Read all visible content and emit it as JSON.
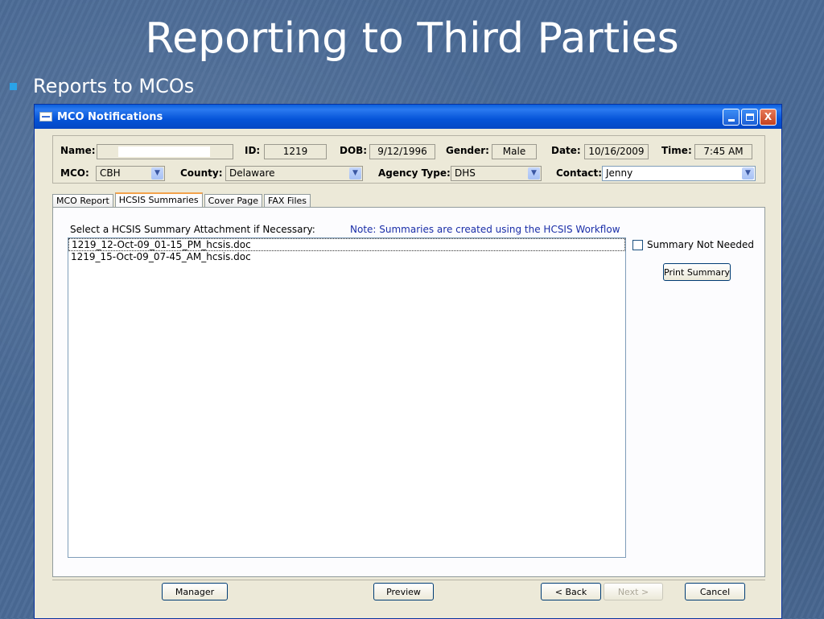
{
  "slide": {
    "title": "Reporting to Third Parties",
    "bullet": "Reports to MCOs"
  },
  "window": {
    "title": "MCO Notifications",
    "min_label": "",
    "close_label": "X"
  },
  "header": {
    "name_label": "Name:",
    "name_value": "",
    "id_label": "ID:",
    "id_value": "1219",
    "dob_label": "DOB:",
    "dob_value": "9/12/1996",
    "gender_label": "Gender:",
    "gender_value": "Male",
    "date_label": "Date:",
    "date_value": "10/16/2009",
    "time_label": "Time:",
    "time_value": "7:45 AM",
    "mco_label": "MCO:",
    "mco_value": "CBH",
    "county_label": "County:",
    "county_value": "Delaware",
    "agency_label": "Agency Type:",
    "agency_value": "DHS",
    "contact_label": "Contact:",
    "contact_value": "Jenny"
  },
  "tabs": [
    {
      "label": "MCO Report"
    },
    {
      "label": "HCSIS Summaries"
    },
    {
      "label": "Cover Page"
    },
    {
      "label": "FAX Files"
    }
  ],
  "hcsis": {
    "select_label": "Select a HCSIS Summary Attachment if Necessary:",
    "note": "Note: Summaries are created using the HCSIS Workflow",
    "files": [
      "1219_12-Oct-09_01-15_PM_hcsis.doc",
      "1219_15-Oct-09_07-45_AM_hcsis.doc"
    ],
    "summary_not_needed_label": "Summary Not Needed",
    "summary_not_needed_checked": false,
    "print_summary_label": "Print Summary"
  },
  "footer": {
    "manager_label": "Manager",
    "preview_label": "Preview",
    "back_label": "< Back",
    "next_label": "Next >",
    "cancel_label": "Cancel"
  }
}
